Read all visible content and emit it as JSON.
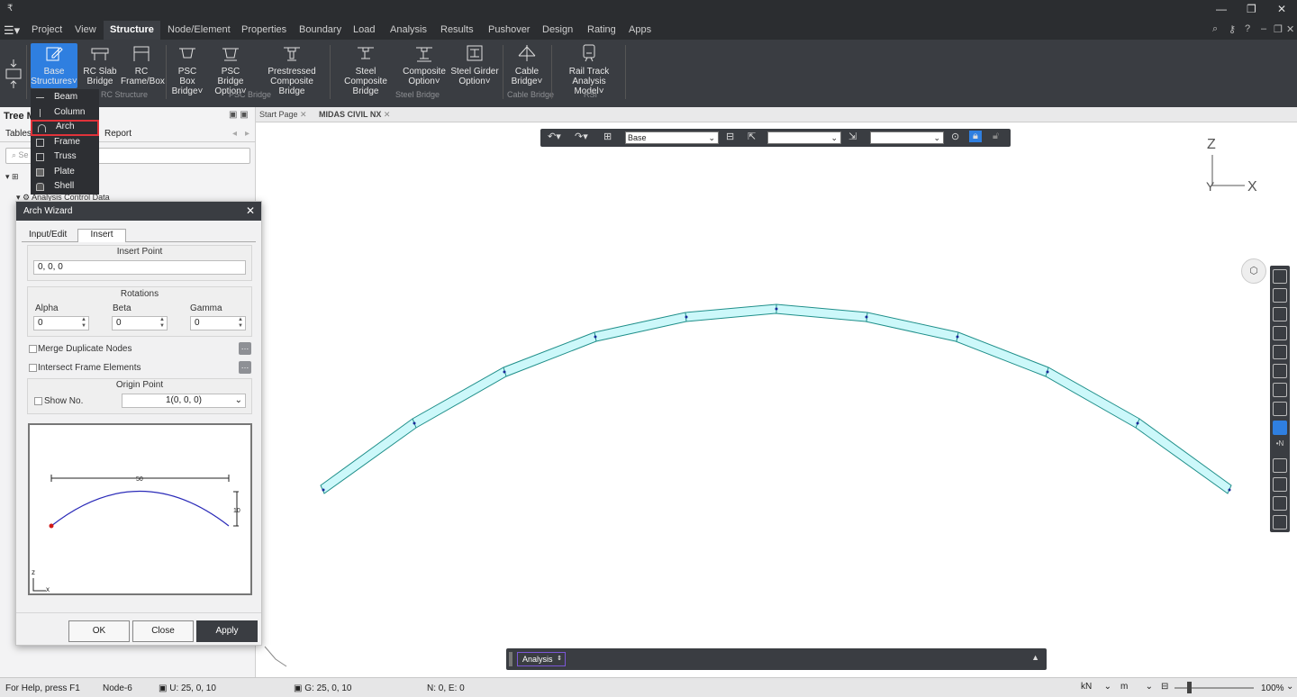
{
  "titlebar": {
    "quick_label": "₹"
  },
  "menus": [
    "Project",
    "View",
    "Structure",
    "Node/Element",
    "Properties",
    "Boundary",
    "Load",
    "Analysis",
    "Results",
    "Pushover",
    "Design",
    "Rating",
    "Apps"
  ],
  "ribbon": {
    "buttons": [
      {
        "l1": "Base",
        "l2": "Structures˅"
      },
      {
        "l1": "RC Slab",
        "l2": "Bridge"
      },
      {
        "l1": "RC",
        "l2": "Frame/Box"
      },
      {
        "l1": "PSC Box",
        "l2": "Bridge˅"
      },
      {
        "l1": "PSC Bridge",
        "l2": "Option˅"
      },
      {
        "l1": "Prestressed",
        "l2": "Composite Bridge"
      },
      {
        "l1": "Steel Composite",
        "l2": "Bridge"
      },
      {
        "l1": "Composite",
        "l2": "Option˅"
      },
      {
        "l1": "Steel Girder",
        "l2": "Option˅"
      },
      {
        "l1": "Cable",
        "l2": "Bridge˅"
      },
      {
        "l1": "Rail Track",
        "l2": "Analysis Model˅"
      }
    ],
    "groups": [
      "RC Structure",
      "PSC Bridge",
      "Steel Bridge",
      "Cable Bridge",
      "RSI"
    ]
  },
  "dropdown": [
    "Beam",
    "Column",
    "Arch",
    "Frame",
    "Truss",
    "Plate",
    "Shell"
  ],
  "left_panel": {
    "title": "Tree M",
    "tab_tables": "Tables",
    "tab_report": "Report",
    "search_placeholder": "Se",
    "tree_item": "Analysis Control Data"
  },
  "wizard": {
    "title": "Arch Wizard",
    "tabs": [
      "Input/Edit",
      "Insert"
    ],
    "insert_point_label": "Insert Point",
    "insert_point_value": "0, 0, 0",
    "rotations_label": "Rotations",
    "alpha_label": "Alpha",
    "beta_label": "Beta",
    "gamma_label": "Gamma",
    "alpha_value": "0",
    "beta_value": "0",
    "gamma_value": "0",
    "merge_label": "Merge Duplicate Nodes",
    "intersect_label": "Intersect Frame Elements",
    "origin_label": "Origin Point",
    "show_no_label": "Show No.",
    "origin_value": "1(0, 0, 0)",
    "dim_span": "50",
    "dim_height": "10",
    "axis_z": "z",
    "axis_x": "x",
    "ok": "OK",
    "close": "Close",
    "apply": "Apply"
  },
  "doc_tabs": [
    "Start Page",
    "MIDAS CIVIL NX"
  ],
  "view_toolbar": {
    "base_value": "Base"
  },
  "axes": {
    "z": "Z",
    "x": "X",
    "y": "Y"
  },
  "command": {
    "mode": "Analysis"
  },
  "status": {
    "help": "For Help, press F1",
    "node": "Node-6",
    "u": "U: 25, 0, 10",
    "g": "G: 25, 0, 10",
    "ne": "N: 0, E: 0",
    "force_unit": "kN",
    "length_unit": "m",
    "zoom": "100%"
  }
}
